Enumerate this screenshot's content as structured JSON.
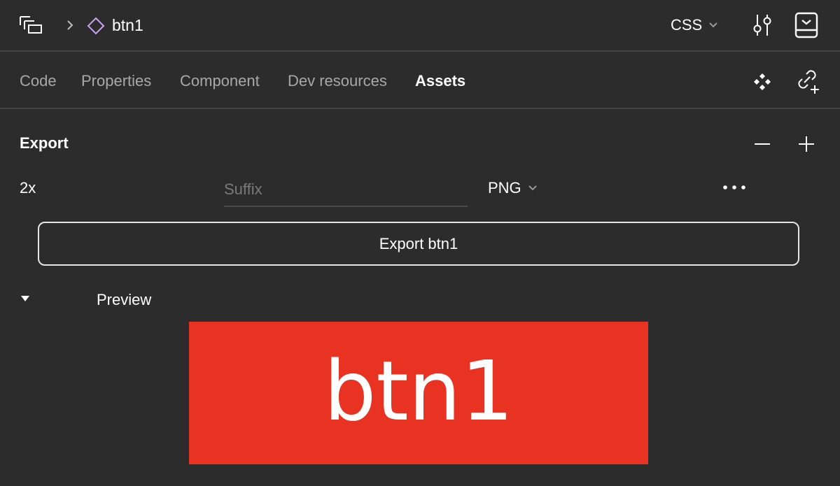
{
  "header": {
    "layers_icon": "layers-icon",
    "breadcrumb_separator_icon": "chevron-right-icon",
    "component_icon": "component-diamond-icon",
    "breadcrumb_label": "btn1",
    "language": "CSS",
    "language_chevron_icon": "chevron-down-icon",
    "settings_icon": "sliders-icon",
    "panel_icon": "panel-collapse-icon"
  },
  "tabs": [
    {
      "label": "Code",
      "active": false
    },
    {
      "label": "Properties",
      "active": false
    },
    {
      "label": "Component",
      "active": false
    },
    {
      "label": "Dev resources",
      "active": false
    },
    {
      "label": "Assets",
      "active": true
    }
  ],
  "tab_icons": {
    "instances_icon": "instances-icon",
    "link_add_icon": "link-add-icon"
  },
  "export": {
    "title": "Export",
    "minus_icon": "minus-icon",
    "plus_icon": "plus-icon",
    "scale": "2x",
    "suffix_placeholder": "Suffix",
    "suffix_value": "",
    "format": "PNG",
    "format_chevron_icon": "chevron-down-icon",
    "more_icon": "more-horizontal-icon",
    "button_label": "Export btn1"
  },
  "preview": {
    "caret_icon": "caret-down-icon",
    "label": "Preview",
    "image_text": "btn1",
    "image_background": "#e83222",
    "image_text_color": "#ffffff"
  },
  "colors": {
    "background": "#2c2c2c",
    "divider": "#444444",
    "text_primary": "#ffffff",
    "text_inactive": "#a8a8a8",
    "placeholder": "#7a7a7a",
    "component_accent": "#c9a4f5"
  }
}
